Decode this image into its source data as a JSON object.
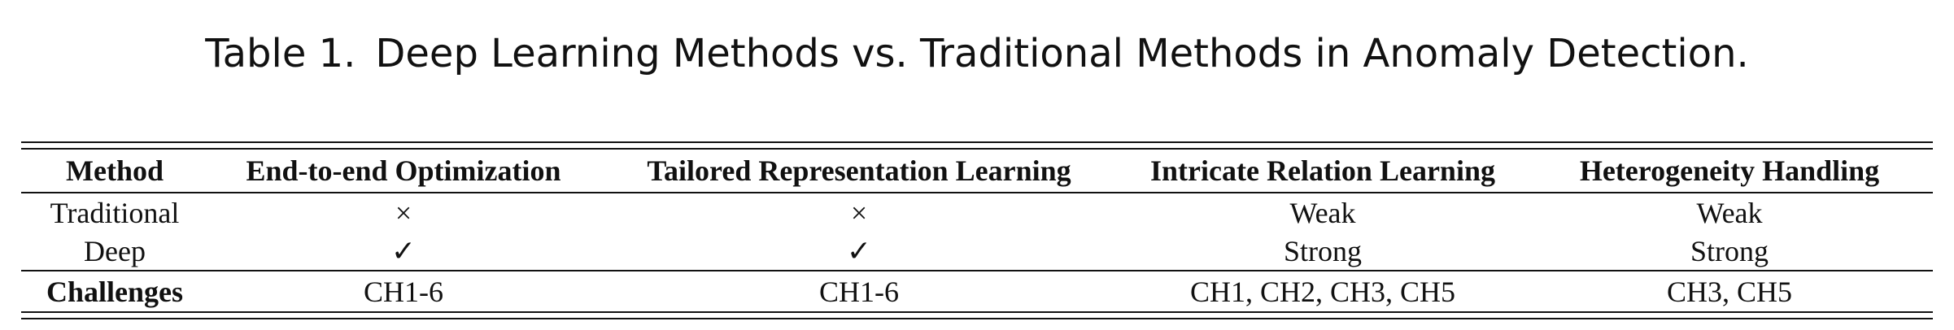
{
  "caption": {
    "label": "Table 1.",
    "text": "Deep Learning Methods vs. Traditional Methods in Anomaly Detection."
  },
  "table": {
    "headers": [
      "Method",
      "End-to-end Optimization",
      "Tailored Representation Learning",
      "Intricate Relation Learning",
      "Heterogeneity Handling"
    ],
    "rows": [
      [
        "Traditional",
        "×",
        "×",
        "Weak",
        "Weak"
      ],
      [
        "Deep",
        "✓",
        "✓",
        "Strong",
        "Strong"
      ]
    ],
    "challenges_row": [
      "Challenges",
      "CH1-6",
      "CH1-6",
      "CH1, CH2, CH3, CH5",
      "CH3, CH5"
    ]
  }
}
